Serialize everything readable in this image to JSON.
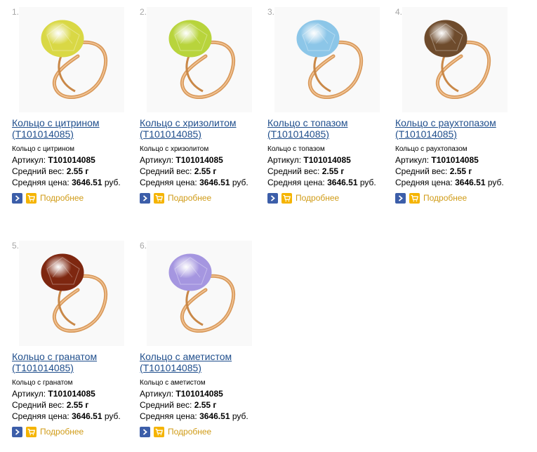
{
  "labels": {
    "article": "Артикул:",
    "weight": "Средний вес:",
    "price": "Средняя цена:",
    "more": "Подробнее"
  },
  "products": [
    {
      "num": "1.",
      "title": "Кольцо с цитрином (Т101014085)",
      "subtitle": "Кольцо с цитрином",
      "article": "Т101014085",
      "weight": "2.55 г",
      "price": "3646.51",
      "currency": "руб.",
      "stone_color": "#d9d845"
    },
    {
      "num": "2.",
      "title": "Кольцо с хризолитом (Т101014085)",
      "subtitle": "Кольцо с хризолитом",
      "article": "Т101014085",
      "weight": "2.55 г",
      "price": "3646.51",
      "currency": "руб.",
      "stone_color": "#b8d43c"
    },
    {
      "num": "3.",
      "title": "Кольцо с топазом (Т101014085)",
      "subtitle": "Кольцо с топазом",
      "article": "Т101014085",
      "weight": "2.55 г",
      "price": "3646.51",
      "currency": "руб.",
      "stone_color": "#8cc6e8"
    },
    {
      "num": "4.",
      "title": "Кольцо с раухтопазом (Т101014085)",
      "subtitle": "Кольцо с раухтопазом",
      "article": "Т101014085",
      "weight": "2.55 г",
      "price": "3646.51",
      "currency": "руб.",
      "stone_color": "#6e4b2c"
    },
    {
      "num": "5.",
      "title": "Кольцо с гранатом (Т101014085)",
      "subtitle": "Кольцо с гранатом",
      "article": "Т101014085",
      "weight": "2.55 г",
      "price": "3646.51",
      "currency": "руб.",
      "stone_color": "#7e2710"
    },
    {
      "num": "6.",
      "title": "Кольцо с аметистом (Т101014085)",
      "subtitle": "Кольцо с аметистом",
      "article": "Т101014085",
      "weight": "2.55 г",
      "price": "3646.51",
      "currency": "руб.",
      "stone_color": "#a596e0"
    }
  ],
  "colors": {
    "link": "#1f4e8c",
    "more": "#d09b16",
    "arrow_button": "#3c5ea9",
    "cart_button": "#f5b400",
    "gold": "#d99a5c"
  },
  "icons": {
    "arrow": "chevron-right-icon",
    "cart": "cart-icon"
  }
}
